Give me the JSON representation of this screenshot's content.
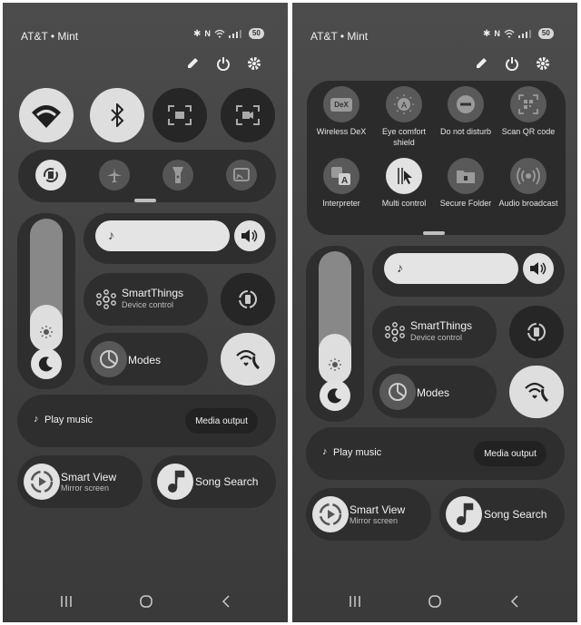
{
  "status": {
    "carrier": "AT&T • Mint",
    "battery": "50"
  },
  "left": {
    "media_card": {
      "title": "Play music",
      "output_button": "Media output"
    },
    "smartthings": {
      "title": "SmartThings",
      "subtitle": "Device control"
    },
    "modes": {
      "label": "Modes"
    },
    "smart_view": {
      "title": "Smart View",
      "subtitle": "Mirror screen"
    },
    "song_search": {
      "label": "Song Search"
    }
  },
  "right": {
    "grid_labels": [
      "Wireless DeX",
      "Eye comfort shield",
      "Do not disturb",
      "Scan QR code",
      "Interpreter",
      "Multi control",
      "Secure Folder",
      "Audio broadcast"
    ],
    "dex_text": "DeX",
    "media_card": {
      "title": "Play music",
      "output_button": "Media output"
    },
    "smartthings": {
      "title": "SmartThings",
      "subtitle": "Device control"
    },
    "modes": {
      "label": "Modes"
    },
    "smart_view": {
      "title": "Smart View",
      "subtitle": "Mirror screen"
    },
    "song_search": {
      "label": "Song Search"
    }
  },
  "brightness_level": 0.35,
  "right_brightness_level": 0.38,
  "icons": [
    "pencil-icon",
    "power-icon",
    "gear-icon",
    "wifi-icon",
    "bluetooth-icon",
    "screen-capture-icon",
    "screen-record-icon",
    "auto-rotate-icon",
    "airplane-icon",
    "flashlight-icon",
    "cast-icon",
    "music-note-icon",
    "volume-icon",
    "smartthings-icon",
    "rotation-lock-icon",
    "modes-icon",
    "wifi-calling-icon",
    "sun-icon",
    "moon-icon",
    "smart-view-icon",
    "song-search-icon"
  ]
}
